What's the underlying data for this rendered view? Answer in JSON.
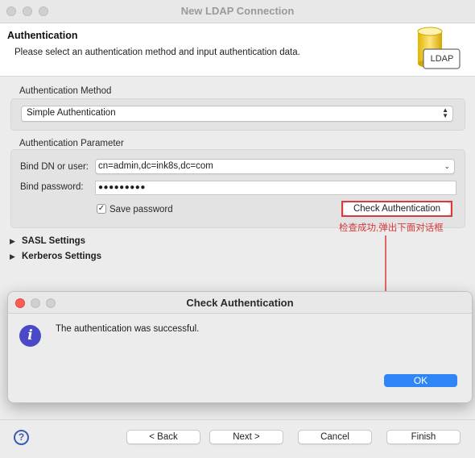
{
  "window": {
    "title": "New LDAP Connection"
  },
  "header": {
    "title": "Authentication",
    "description": "Please select an authentication method and input authentication data.",
    "logo_text": "LDAP"
  },
  "auth_method": {
    "label": "Authentication Method",
    "selected": "Simple Authentication"
  },
  "auth_param": {
    "label": "Authentication Parameter",
    "bind_dn_label": "Bind DN or user:",
    "bind_dn_value": "cn=admin,dc=ink8s,dc=com",
    "password_label": "Bind password:",
    "password_value": "●●●●●●●●●",
    "save_password_label": "Save password",
    "save_password_checked": true,
    "check_button": "Check Authentication"
  },
  "annotation": {
    "text": "检查成功,弹出下面对话框",
    "color": "#d93a3a"
  },
  "sections": {
    "sasl": "SASL Settings",
    "kerberos": "Kerberos Settings"
  },
  "dialog": {
    "title": "Check Authentication",
    "message": "The authentication was successful.",
    "ok_label": "OK",
    "accent_color": "#2f85f5",
    "icon": "info-icon"
  },
  "footer": {
    "back": "< Back",
    "next": "Next >",
    "cancel": "Cancel",
    "finish": "Finish",
    "help_icon": "question-mark-icon"
  }
}
